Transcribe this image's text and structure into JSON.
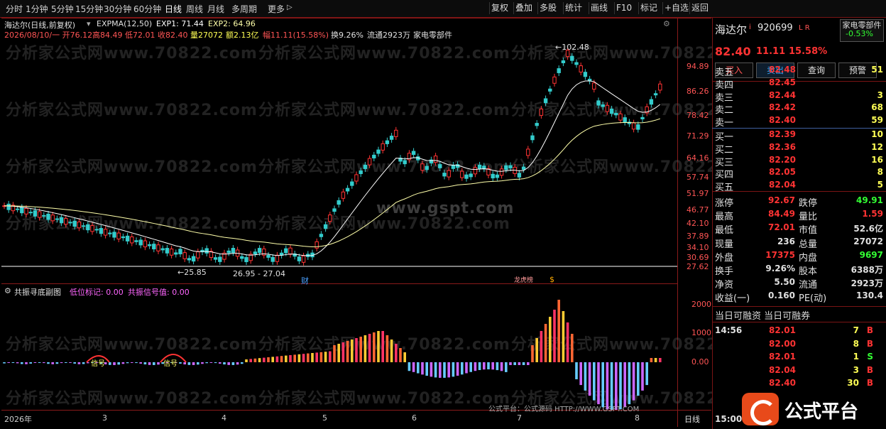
{
  "toolbar": {
    "periods": [
      "分时",
      "1分钟",
      "5分钟",
      "15分钟",
      "30分钟",
      "60分钟",
      "日线",
      "周线",
      "月线",
      "多周期",
      "更多"
    ],
    "more_arrow": "▷",
    "right_buttons": [
      "复权",
      "叠加",
      "多股",
      "统计",
      "画线",
      "F10",
      "标记",
      "+自选",
      "返回"
    ]
  },
  "chart_header": {
    "title": "海达尔(日线,前复权)",
    "indicator": "EXPMA(12,50)",
    "exp1": "EXP1: 71.44",
    "exp2": "EXP2: 64.96",
    "date_open": "2026/08/10/一 开76.12",
    "high": "高84.49",
    "low": "低72.01",
    "close": "收82.40",
    "volume": "量27072",
    "amount": "额2.13亿",
    "change": "幅11.11(15.58%)",
    "turnover": "换9.26%",
    "float": "流通2923万",
    "sector": "家电零部件"
  },
  "price_axis": [
    "94.89",
    "86.26",
    "78.42",
    "71.29",
    "64.16",
    "57.74",
    "51.97",
    "46.77",
    "42.10",
    "37.89",
    "34.10",
    "30.69",
    "27.62"
  ],
  "annotations": {
    "high_label": "102.48",
    "low_label": "25.85",
    "range_label": "26.95 - 27.04",
    "event1": "财",
    "event2": "龙虎榜",
    "event3": "$"
  },
  "watermark": {
    "text": "分析家公式网www.70822.com",
    "site": "www.gspt.com",
    "footer": "公式平台：公式源码 HTTP://WWW.GSPT.COM"
  },
  "sub_header": {
    "title": "共振寻底副图",
    "low_mark": "低位标记: 0.00",
    "signal": "共振信号值: 0.00",
    "signal_tag": "信号"
  },
  "sub_axis": [
    "2000",
    "1000",
    "0.00"
  ],
  "date_axis": [
    "2026年",
    "3",
    "4",
    "5",
    "6",
    "7",
    "8"
  ],
  "timeframe": "日线",
  "stock": {
    "name": "海达尔",
    "flag": "i",
    "code": "920699",
    "tags": "L R",
    "sector_btn": "家电零部件",
    "sector_pct": "-0.53%",
    "price": "82.40",
    "change": "11.11",
    "pct": "15.58%"
  },
  "actions": [
    "买入",
    "卖出",
    "查询",
    "预警"
  ],
  "asks": [
    {
      "label": "卖五",
      "price": "82.48",
      "vol": "51"
    },
    {
      "label": "卖四",
      "price": "82.45",
      "vol": ""
    },
    {
      "label": "卖三",
      "price": "82.44",
      "vol": "3"
    },
    {
      "label": "卖二",
      "price": "82.42",
      "vol": "68"
    },
    {
      "label": "卖一",
      "price": "82.40",
      "vol": "59"
    }
  ],
  "bids": [
    {
      "label": "买一",
      "price": "82.39",
      "vol": "10"
    },
    {
      "label": "买二",
      "price": "82.36",
      "vol": "12"
    },
    {
      "label": "买三",
      "price": "82.20",
      "vol": "16"
    },
    {
      "label": "买四",
      "price": "82.05",
      "vol": "8"
    },
    {
      "label": "买五",
      "price": "82.04",
      "vol": "5"
    }
  ],
  "stats": [
    {
      "l1": "涨停",
      "v1": "92.67",
      "l2": "跌停",
      "v2": "49.91"
    },
    {
      "l1": "最高",
      "v1": "84.49",
      "l2": "量比",
      "v2": "1.59"
    },
    {
      "l1": "最低",
      "v1": "72.01",
      "l2": "市值",
      "v2": "52.6亿"
    },
    {
      "l1": "现量",
      "v1": "236",
      "l2": "总量",
      "v2": "27072"
    },
    {
      "l1": "外盘",
      "v1": "17375",
      "l2": "内盘",
      "v2": "9697"
    },
    {
      "l1": "换手",
      "v1": "9.26%",
      "l2": "股本",
      "v2": "6388万"
    },
    {
      "l1": "净资",
      "v1": "5.50",
      "l2": "流通",
      "v2": "2923万"
    },
    {
      "l1": "收益(一)",
      "v1": "0.160",
      "l2": "PE(动)",
      "v2": "130.4"
    }
  ],
  "margin_header": "当日可融资 当日可融券",
  "trades": [
    {
      "time": "14:56",
      "price": "82.01",
      "vol": "7",
      "side": "B"
    },
    {
      "time": "",
      "price": "82.00",
      "vol": "8",
      "side": "B"
    },
    {
      "time": "",
      "price": "82.01",
      "vol": "1",
      "side": "S"
    },
    {
      "time": "",
      "price": "82.04",
      "vol": "3",
      "side": "B"
    },
    {
      "time": "",
      "price": "82.40",
      "vol": "30",
      "side": "B"
    }
  ],
  "bottom_time": "15:00",
  "logo_text": "公式平台",
  "colors": {
    "up": "#ff3333",
    "down": "#33cccc",
    "yellow": "#ffff00",
    "green": "#33ff33",
    "border": "#7a1414"
  }
}
